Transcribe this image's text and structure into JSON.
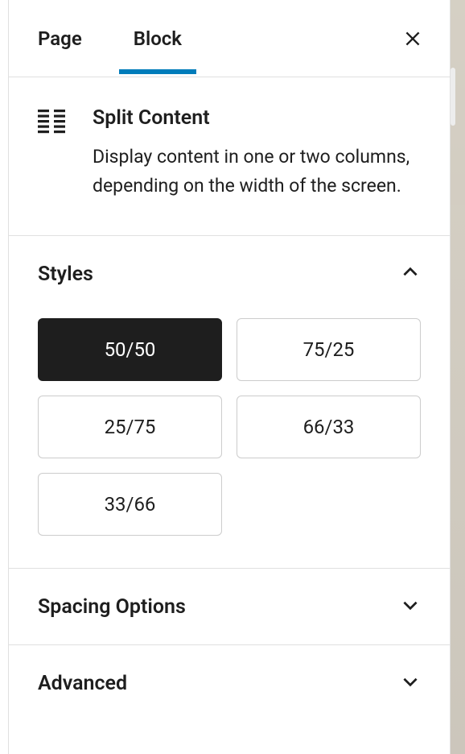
{
  "tabs": {
    "page": "Page",
    "block": "Block"
  },
  "block": {
    "title": "Split Content",
    "description": "Display content in one or two columns, depending on the width of the screen."
  },
  "panels": {
    "styles": {
      "title": "Styles",
      "options": [
        "50/50",
        "75/25",
        "25/75",
        "66/33",
        "33/66"
      ]
    },
    "spacing": {
      "title": "Spacing Options"
    },
    "advanced": {
      "title": "Advanced"
    }
  }
}
